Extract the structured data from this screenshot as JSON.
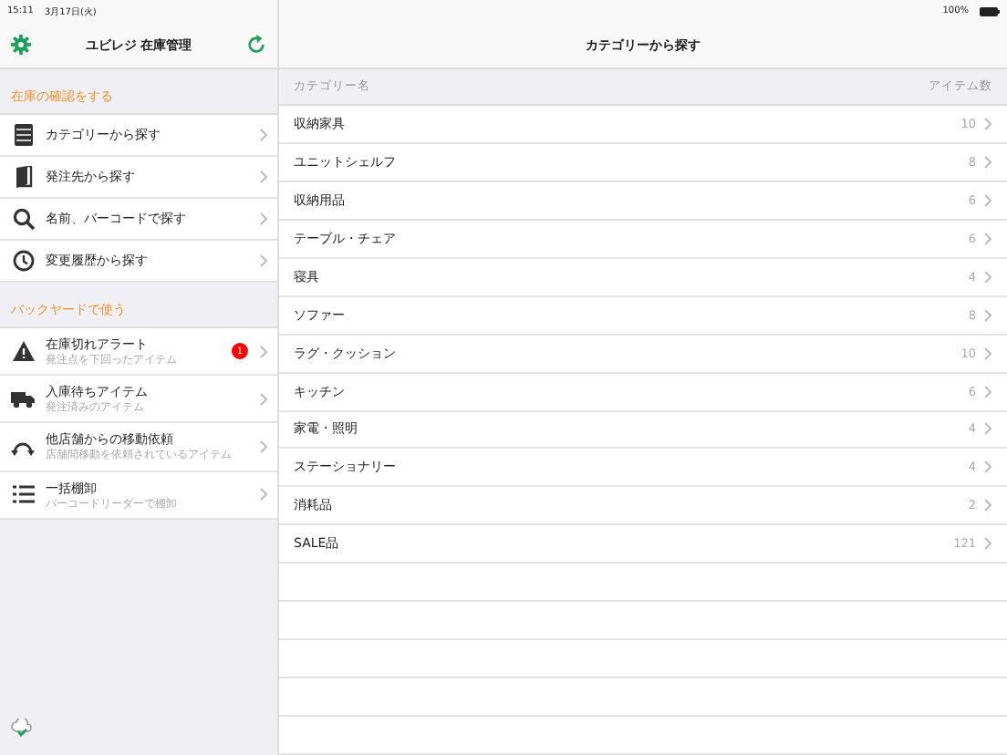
{
  "status_bar": {
    "time": "15:11",
    "date": "3月17日(火)",
    "battery": "100%"
  },
  "sidebar": {
    "title": "ユビレジ 在庫管理",
    "sections": [
      {
        "header": "在庫の確認をする",
        "items": [
          {
            "label": "カテゴリーから探す"
          },
          {
            "label": "発注先から探す"
          },
          {
            "label": "名前、バーコードで探す"
          },
          {
            "label": "変更履歴から探す"
          }
        ]
      },
      {
        "header": "バックヤードで使う",
        "items": [
          {
            "label": "在庫切れアラート",
            "subtitle": "発注点を下回ったアイテム",
            "badge": "1"
          },
          {
            "label": "入庫待ちアイテム",
            "subtitle": "発注済みのアイテム"
          },
          {
            "label": "他店舗からの移動依頼",
            "subtitle": "店舗間移動を依頼されているアイテム"
          },
          {
            "label": "一括棚卸",
            "subtitle": "バーコードリーダーで棚卸"
          }
        ]
      }
    ]
  },
  "main": {
    "title": "カテゴリーから探す",
    "columns": [
      "カテゴリー名",
      "アイテム数"
    ],
    "rows": [
      {
        "name": "収納家具",
        "count": "10"
      },
      {
        "name": "ユニットシェルフ",
        "count": "8"
      },
      {
        "name": "収納用品",
        "count": "6"
      },
      {
        "name": "テーブル・チェア",
        "count": "6"
      },
      {
        "name": "寝具",
        "count": "4"
      },
      {
        "name": "ソファー",
        "count": "8"
      },
      {
        "name": "ラグ・クッション",
        "count": "10"
      },
      {
        "name": "キッチン",
        "count": "6"
      },
      {
        "name": "家電・照明",
        "count": "4"
      },
      {
        "name": "ステーショナリー",
        "count": "4"
      },
      {
        "name": "消耗品",
        "count": "2"
      },
      {
        "name": "SALE品",
        "count": "121"
      }
    ]
  }
}
